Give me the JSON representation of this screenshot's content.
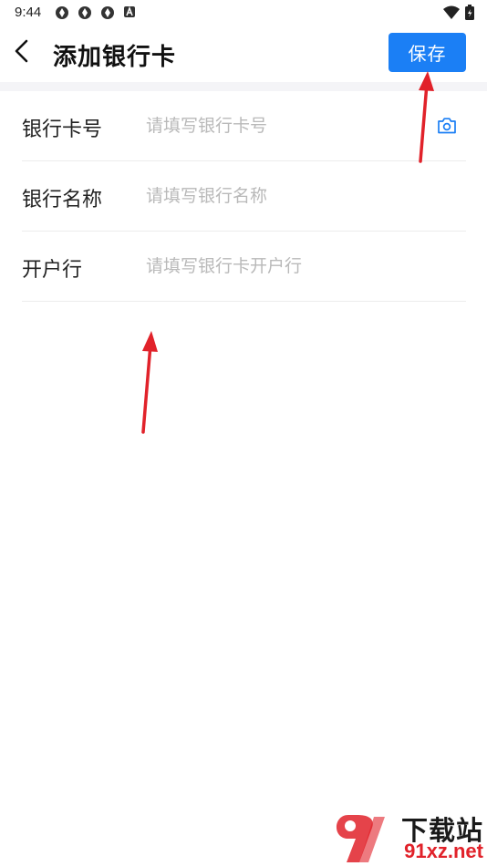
{
  "status_bar": {
    "time": "9:44",
    "notification_icons": [
      "aperture-icon",
      "aperture-icon",
      "aperture-icon",
      "font-icon"
    ],
    "right_icons": [
      "wifi-icon",
      "battery-icon"
    ]
  },
  "header": {
    "back_icon": "chevron-left-icon",
    "title": "添加银行卡",
    "save_label": "保存"
  },
  "form": {
    "card_number": {
      "label": "银行卡号",
      "placeholder": "请填写银行卡号",
      "value": "",
      "icon": "camera-icon"
    },
    "bank_name": {
      "label": "银行名称",
      "placeholder": "请填写银行名称",
      "value": ""
    },
    "bank_branch": {
      "label": "开户行",
      "placeholder": "请填写银行卡开户行",
      "value": ""
    }
  },
  "watermark": {
    "brand": "下载站",
    "site": "91xz.net"
  },
  "colors": {
    "accent": "#1b7ff5",
    "annotation": "#e1222a",
    "placeholder": "#b9b9b9"
  }
}
